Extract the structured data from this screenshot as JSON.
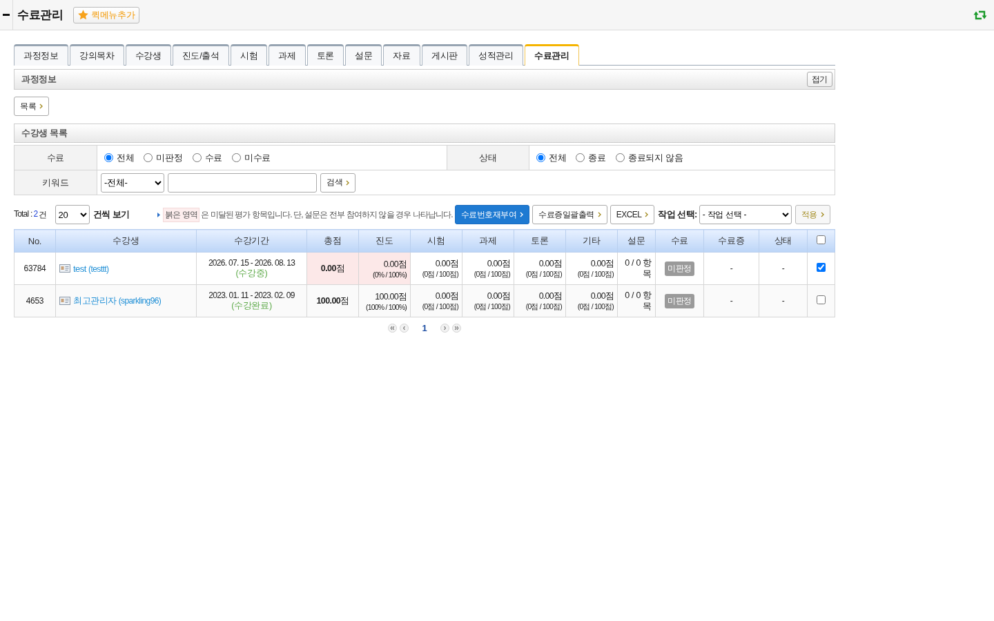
{
  "header": {
    "title": "수료관리",
    "quickmenu_button": "퀵메뉴추가"
  },
  "tabs": [
    {
      "label": "과정정보",
      "selected": false
    },
    {
      "label": "강의목차",
      "selected": false
    },
    {
      "label": "수강생",
      "selected": false
    },
    {
      "label": "진도/출석",
      "selected": false
    },
    {
      "label": "시험",
      "selected": false
    },
    {
      "label": "과제",
      "selected": false
    },
    {
      "label": "토론",
      "selected": false
    },
    {
      "label": "설문",
      "selected": false
    },
    {
      "label": "자료",
      "selected": false
    },
    {
      "label": "게시판",
      "selected": false
    },
    {
      "label": "성적관리",
      "selected": false
    },
    {
      "label": "수료관리",
      "selected": true
    }
  ],
  "course_info_section": {
    "title": "과정정보",
    "collapse_button": "접기"
  },
  "list_button": "목록",
  "student_list_section": {
    "title": "수강생 목록"
  },
  "filters": {
    "completion": {
      "label": "수료",
      "options": [
        {
          "label": "전체",
          "selected": true
        },
        {
          "label": "미판정",
          "selected": false
        },
        {
          "label": "수료",
          "selected": false
        },
        {
          "label": "미수료",
          "selected": false
        }
      ]
    },
    "status": {
      "label": "상태",
      "options": [
        {
          "label": "전체",
          "selected": true
        },
        {
          "label": "종료",
          "selected": false
        },
        {
          "label": "종료되지 않음",
          "selected": false
        }
      ]
    },
    "keyword": {
      "label": "키워드",
      "select_value": "-전체-",
      "search_button": "검색"
    }
  },
  "toolbar": {
    "total_label": "Total :",
    "total_count": "2",
    "total_unit": "건",
    "page_size": "20",
    "page_size_label": "건씩 보기",
    "legend_highlight": "붉은 영역",
    "legend_text": "은 미달된 평가 항목입니다. 단, 설문은 전부 참여하지 않을 경우 나타납니다.",
    "buttons": [
      {
        "label": "수료번호재부여",
        "kind": "primary"
      },
      {
        "label": "수료증일괄출력",
        "kind": "default"
      },
      {
        "label": "EXCEL",
        "kind": "default"
      }
    ],
    "action_label": "작업 선택:",
    "action_select": "- 작업 선택 -",
    "apply_button": "적용"
  },
  "table": {
    "columns": [
      "No.",
      "수강생",
      "수강기간",
      "총점",
      "진도",
      "시험",
      "과제",
      "토론",
      "기타",
      "설문",
      "수료",
      "수료증",
      "상태"
    ],
    "select_all_checked": false,
    "rows": [
      {
        "no": "63784",
        "name": "test",
        "user_id": "(testtt)",
        "period": "2026. 07. 15 - 2026. 08. 13",
        "period_status": "(수강중)",
        "total": {
          "text": "**0.00**점",
          "unmet": true
        },
        "scores": [
          {
            "value": "0.00점",
            "detail": "(0% / 100%)",
            "unmet": true
          },
          {
            "value": "0.00점",
            "detail": "(0점 / 100점)",
            "unmet": false
          },
          {
            "value": "0.00점",
            "detail": "(0점 / 100점)",
            "unmet": false
          },
          {
            "value": "0.00점",
            "detail": "(0점 / 100점)",
            "unmet": false
          },
          {
            "value": "0.00점",
            "detail": "(0점 / 100점)",
            "unmet": false
          }
        ],
        "survey": "0 / 0 항목",
        "completion": "미판정",
        "certificate": "-",
        "status": "-",
        "checked": true
      },
      {
        "no": "4653",
        "name": "최고관리자",
        "user_id": "(sparkling96)",
        "period": "2023. 01. 11 - 2023. 02. 09",
        "period_status": "(수강완료)",
        "total": {
          "text": "**100.00**점",
          "unmet": false
        },
        "scores": [
          {
            "value": "100.00점",
            "detail": "(100% / 100%)",
            "unmet": false
          },
          {
            "value": "0.00점",
            "detail": "(0점 / 100점)",
            "unmet": false
          },
          {
            "value": "0.00점",
            "detail": "(0점 / 100점)",
            "unmet": false
          },
          {
            "value": "0.00점",
            "detail": "(0점 / 100점)",
            "unmet": false
          },
          {
            "value": "0.00점",
            "detail": "(0점 / 100점)",
            "unmet": false
          }
        ],
        "survey": "0 / 0 항목",
        "completion": "미판정",
        "certificate": "-",
        "status": "-",
        "checked": false
      }
    ]
  },
  "pagination": {
    "pages": [
      {
        "label": "1",
        "selected": true
      }
    ]
  }
}
